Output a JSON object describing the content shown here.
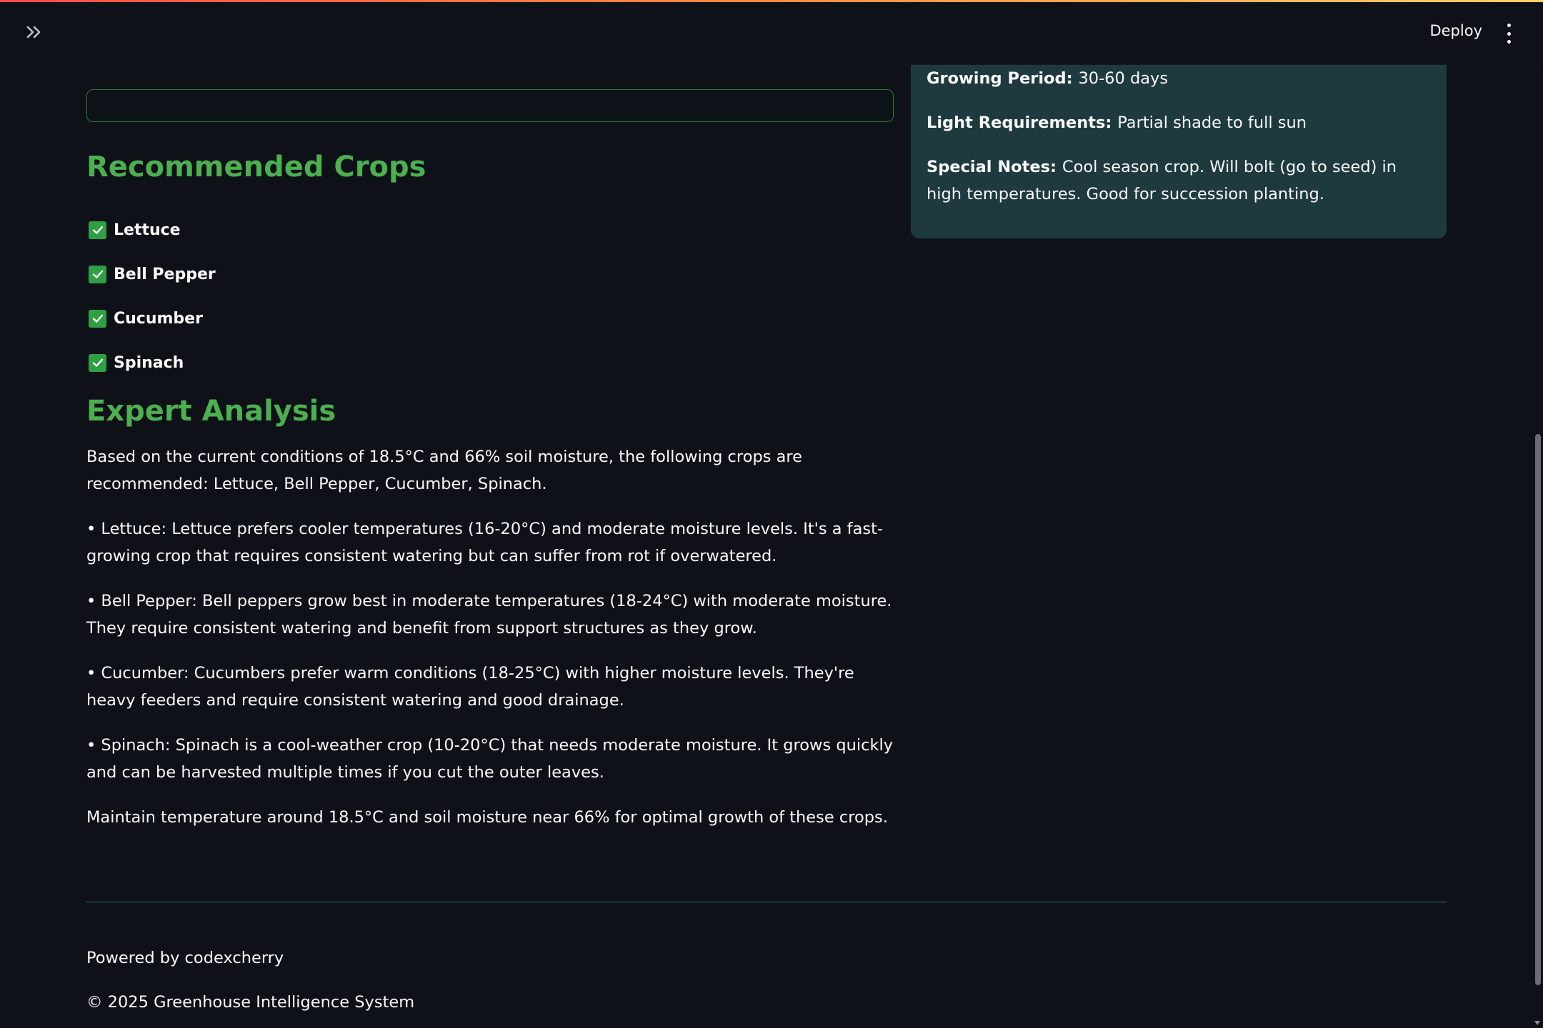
{
  "header": {
    "expand_icon": "double-chevron-right-icon",
    "deploy_label": "Deploy",
    "menu_icon": "vertical-dots-icon"
  },
  "info_card": {
    "growing_period_label": "Growing Period:",
    "growing_period_value": "30-60 days",
    "light_label": "Light Requirements:",
    "light_value": "Partial shade to full sun",
    "notes_label": "Special Notes:",
    "notes_value": "Cool season crop. Will bolt (go to seed) in high temperatures. Good for succession planting."
  },
  "recommended": {
    "heading": "Recommended Crops",
    "crops": [
      "Lettuce",
      "Bell Pepper",
      "Cucumber",
      "Spinach"
    ]
  },
  "analysis": {
    "heading": "Expert Analysis",
    "paragraphs": [
      "Based on the current conditions of 18.5°C and 66% soil moisture, the following crops are recommended: Lettuce, Bell Pepper, Cucumber, Spinach.",
      "• Lettuce: Lettuce prefers cooler temperatures (16-20°C) and moderate moisture levels. It's a fast-growing crop that requires consistent watering but can suffer from rot if overwatered.",
      "• Bell Pepper: Bell peppers grow best in moderate temperatures (18-24°C) with moderate moisture. They require consistent watering and benefit from support structures as they grow.",
      "• Cucumber: Cucumbers prefer warm conditions (18-25°C) with higher moisture levels. They're heavy feeders and require consistent watering and good drainage.",
      "• Spinach: Spinach is a cool-weather crop (10-20°C) that needs moderate moisture. It grows quickly and can be harvested multiple times if you cut the outer leaves.",
      "Maintain temperature around 18.5°C and soil moisture near 66% for optimal growth of these crops."
    ]
  },
  "footer": {
    "powered_by": "Powered by codexcherry",
    "copyright": "© 2025 Greenhouse Intelligence System"
  },
  "colors": {
    "accent_green": "#4caf50",
    "checkbox_green": "#2ea043",
    "card_bg": "#1e3a3f",
    "page_bg": "#0e1117"
  }
}
